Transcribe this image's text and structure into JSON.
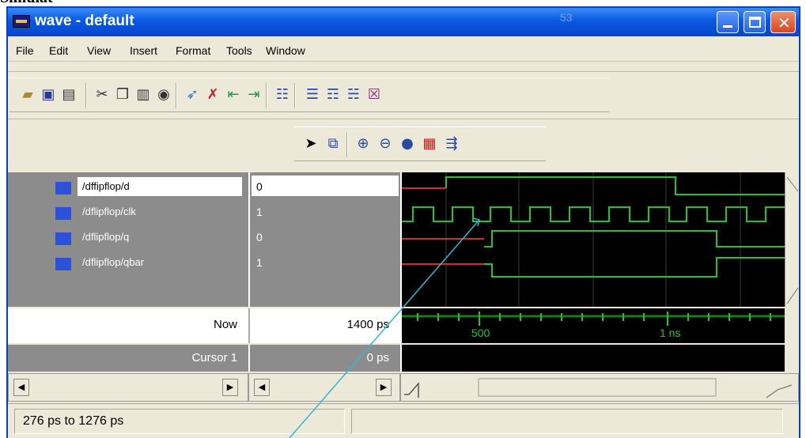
{
  "fragment_text": "Simulat",
  "window": {
    "title": "wave - default",
    "faint_mark": "53"
  },
  "menu": [
    "File",
    "Edit",
    "View",
    "Insert",
    "Format",
    "Tools",
    "Window"
  ],
  "toolbar_icons": {
    "row1": [
      "open-icon",
      "save-icon",
      "print-icon",
      "cut-icon",
      "copy-icon",
      "paste-icon",
      "find-icon",
      "select-icon",
      "delete-icon",
      "insert-arrow-icon",
      "wrap-icon",
      "properties-icon",
      "list-icon",
      "list-add-icon",
      "list-down-icon",
      "clear-icon"
    ],
    "row2": [
      "pointer-icon",
      "zoom-area-icon",
      "zoom-in-icon",
      "zoom-out-icon",
      "zoom-full-icon",
      "cursor-icon",
      "next-edge-icon"
    ]
  },
  "signals": [
    {
      "name": "/dffipflop/d",
      "value": "0"
    },
    {
      "name": "/dflipflop/clk",
      "value": "1"
    },
    {
      "name": "/dflipflop/q",
      "value": "0"
    },
    {
      "name": "/dflipflop/qbar",
      "value": "1"
    }
  ],
  "now": {
    "label": "Now",
    "value": "1400 ps"
  },
  "cursor": {
    "label": "Cursor 1",
    "value": "0 ps"
  },
  "ruler": {
    "label_500": "500",
    "label_1ns": "1 ns"
  },
  "status": {
    "range_text": "276 ps to 1276 ps"
  },
  "colors": {
    "title_bar": "#0a58e3",
    "wave_bg": "#000000",
    "signal_green": "#23c42b",
    "signal_red": "#d42b2b",
    "pointer_line": "#33b7d4"
  }
}
